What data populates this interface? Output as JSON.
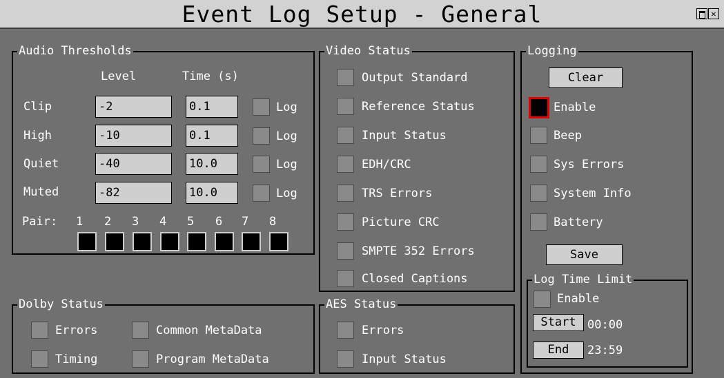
{
  "window": {
    "title": "Event Log Setup - General"
  },
  "audio": {
    "legend": "Audio Thresholds",
    "col_level": "Level",
    "col_time": "Time (s)",
    "log_label": "Log",
    "rows": [
      {
        "label": "Clip",
        "level": "-2",
        "time": "0.1"
      },
      {
        "label": "High",
        "level": "-10",
        "time": "0.1"
      },
      {
        "label": "Quiet",
        "level": "-40",
        "time": "10.0"
      },
      {
        "label": "Muted",
        "level": "-82",
        "time": "10.0"
      }
    ],
    "pair_label": "Pair:",
    "pairs": [
      "1",
      "2",
      "3",
      "4",
      "5",
      "6",
      "7",
      "8"
    ]
  },
  "video": {
    "legend": "Video Status",
    "items": [
      "Output Standard",
      "Reference Status",
      "Input Status",
      "EDH/CRC",
      "TRS Errors",
      "Picture CRC",
      "SMPTE 352 Errors",
      "Closed Captions"
    ]
  },
  "logging": {
    "legend": "Logging",
    "clear_label": "Clear",
    "items": [
      "Enable",
      "Beep",
      "Sys Errors",
      "System Info",
      "Battery"
    ],
    "save_label": "Save"
  },
  "log_time_limit": {
    "legend": "Log Time Limit",
    "enable_label": "Enable",
    "start_label": "Start",
    "start_value": "00:00",
    "end_label": "End",
    "end_value": "23:59"
  },
  "dolby": {
    "legend": "Dolby Status",
    "errors": "Errors",
    "common": "Common MetaData",
    "timing": "Timing",
    "program": "Program MetaData"
  },
  "aes": {
    "legend": "AES Status",
    "items": [
      "Errors",
      "Input Status"
    ]
  },
  "colors": {
    "background": "#707070",
    "titlebar": "#d2d2d2",
    "selected_border": "#e00000"
  }
}
